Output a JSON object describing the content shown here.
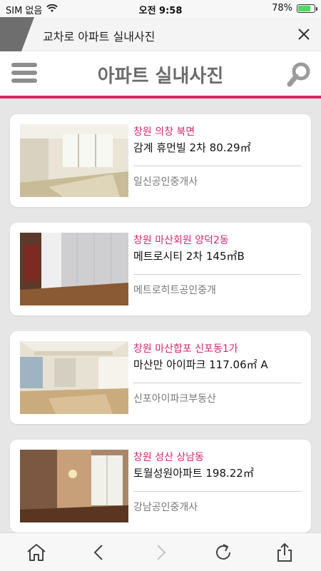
{
  "status_bar": {
    "carrier": "SIM 없음",
    "time": "오전 9:58",
    "battery": "78%",
    "battery_level": 0.78
  },
  "tab": {
    "title": "교차로 아파트 실내사진",
    "close_icon": "close-icon"
  },
  "header": {
    "title": "아파트 실내사진",
    "menu_icon": "hamburger-menu-icon",
    "search_icon": "search-icon"
  },
  "listings": [
    {
      "location": "창원 의창 북면",
      "name": "감계 휴먼빌 2차 80.29㎡",
      "agency": "일신공인중개사"
    },
    {
      "location": "창원 마산회원 양덕2동",
      "name": "메트로시티 2차 145㎡B",
      "agency": "메트로히트공인중개"
    },
    {
      "location": "창원 마산합포 신포동1가",
      "name": "마산만 아이파크 117.06㎡ A",
      "agency": "신포아이파크부동산"
    },
    {
      "location": "창원 성산 상남동",
      "name": "토월성원아파트 198.22㎡",
      "agency": "강남공인중개사"
    }
  ],
  "toolbar": {
    "icons": [
      "home-icon",
      "back-icon",
      "forward-icon",
      "refresh-icon",
      "share-icon"
    ]
  },
  "colors": {
    "accent": "#d6265f",
    "location_text": "#d6266f",
    "list_background": "#e6e6e6",
    "battery": "#4cd964"
  }
}
